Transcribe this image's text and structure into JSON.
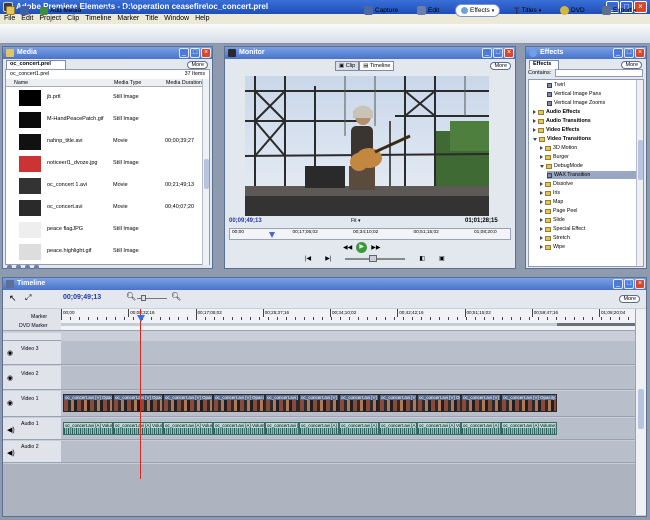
{
  "window": {
    "title": "Adobe Premiere Elements - D:\\operation ceasefire\\oc_concert.prel",
    "min": "_",
    "max": "□",
    "close": "×"
  },
  "menu": [
    "File",
    "Edit",
    "Project",
    "Clip",
    "Timeline",
    "Marker",
    "Title",
    "Window",
    "Help"
  ],
  "toolbar": {
    "add_media": "Add Media",
    "capture": "Capture",
    "edit": "Edit",
    "effects": "Effects",
    "titles": "Titles",
    "dvd": "DVD",
    "export": "Export"
  },
  "media": {
    "title": "Media",
    "tab": "oc_concert.prel",
    "more": "More",
    "filter": "oc_concert1.prel",
    "count": "37 Items",
    "columns": [
      "Name",
      "Media Type",
      "Media Duration"
    ],
    "items": [
      {
        "name": "jb.prtl",
        "type": "Still Image",
        "duration": ""
      },
      {
        "name": "M-HandPeacePatch.gif",
        "type": "Still Image",
        "duration": ""
      },
      {
        "name": "nahnp_title.avi",
        "type": "Movie",
        "duration": "00;00;39;27"
      },
      {
        "name": "noticeerl1_dvoze.jpg",
        "type": "Still Image",
        "duration": ""
      },
      {
        "name": "oc_concert 1.avi",
        "type": "Movie",
        "duration": "00;21;49;13"
      },
      {
        "name": "oc_concert.avi",
        "type": "Movie",
        "duration": "00;40;07;20"
      },
      {
        "name": "peace flagJPG",
        "type": "Still Image",
        "duration": ""
      },
      {
        "name": "peace.highlight.gif",
        "type": "Still Image",
        "duration": ""
      }
    ]
  },
  "monitor": {
    "title": "Monitor",
    "clip_tab": "Clip",
    "timeline_tab": "Timeline",
    "more": "More",
    "current_time": "00;09;49;13",
    "fit": "Fit",
    "total_time": "01;01;28;15",
    "ruler": [
      "00;00",
      "00;17;05;02",
      "00;34;10;02",
      "00;51;15;02",
      "01;08;20;0"
    ],
    "playhead_fraction": 0.14
  },
  "effects": {
    "title": "Effects",
    "tab": "Effects",
    "more": "More",
    "search_label": "Contains:",
    "items": [
      {
        "label": "Twirl",
        "indent": 2,
        "kind": "fx"
      },
      {
        "label": "Vertical Image Pans",
        "indent": 2,
        "kind": "fx"
      },
      {
        "label": "Vertical Image Zooms",
        "indent": 2,
        "kind": "fx"
      },
      {
        "label": "Audio Effects",
        "indent": 0,
        "kind": "folder",
        "bold": true
      },
      {
        "label": "Audio Transitions",
        "indent": 0,
        "kind": "folder",
        "bold": true
      },
      {
        "label": "Video Effects",
        "indent": 0,
        "kind": "folder",
        "bold": true
      },
      {
        "label": "Video Transitions",
        "indent": 0,
        "kind": "folder",
        "bold": true,
        "open": true
      },
      {
        "label": "3D Motion",
        "indent": 1,
        "kind": "folder"
      },
      {
        "label": "Burger",
        "indent": 1,
        "kind": "folder"
      },
      {
        "label": "DebugMode",
        "indent": 1,
        "kind": "folder",
        "open": true
      },
      {
        "label": "WAX Transition",
        "indent": 2,
        "kind": "fx",
        "selected": true
      },
      {
        "label": "Dissolve",
        "indent": 1,
        "kind": "folder"
      },
      {
        "label": "Iris",
        "indent": 1,
        "kind": "folder"
      },
      {
        "label": "Map",
        "indent": 1,
        "kind": "folder"
      },
      {
        "label": "Page Peel",
        "indent": 1,
        "kind": "folder"
      },
      {
        "label": "Slide",
        "indent": 1,
        "kind": "folder"
      },
      {
        "label": "Special Effect",
        "indent": 1,
        "kind": "folder"
      },
      {
        "label": "Stretch",
        "indent": 1,
        "kind": "folder"
      },
      {
        "label": "Wipe",
        "indent": 1,
        "kind": "folder"
      }
    ]
  },
  "timeline": {
    "title": "Timeline",
    "more": "More",
    "current_time": "00;09;49;13",
    "ruler": [
      "00;00",
      "00;08;32;16",
      "00;17;05;02",
      "00;25;37;16",
      "00;34;10;02",
      "00;42;42;16",
      "00;51;15;02",
      "00;59;47;16",
      "01;08;20;04"
    ],
    "marker_label": "Marker",
    "dvd_marker_label": "DVD Marker",
    "tracks": [
      "Video 3",
      "Video 2",
      "Video 1",
      "Audio 1",
      "Audio 2"
    ],
    "video_clip_label": "oc_concert.avi [V] Opacity:Opacity",
    "audio_clip_label": "oc_concert.avi [A] Volume:Level"
  }
}
